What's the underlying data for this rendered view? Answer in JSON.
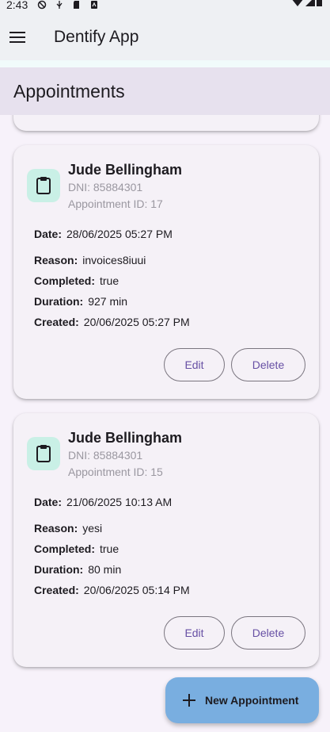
{
  "status_bar": {
    "time": "2:43"
  },
  "app_bar": {
    "title": "Dentify App"
  },
  "section": {
    "title": "Appointments"
  },
  "labels": {
    "date": "Date:",
    "reason": "Reason:",
    "completed": "Completed:",
    "duration": "Duration:",
    "created": "Created:",
    "edit": "Edit",
    "delete": "Delete"
  },
  "appointments": [
    {
      "patient": "Jude Bellingham",
      "dni": "DNI: 85884301",
      "appointment_id": "Appointment ID: 17",
      "date": "28/06/2025 05:27 PM",
      "reason": "invoices8iuui",
      "completed": "true",
      "duration": "927 min",
      "created": "20/06/2025 05:27 PM"
    },
    {
      "patient": "Jude Bellingham",
      "dni": "DNI: 85884301",
      "appointment_id": "Appointment ID: 15",
      "date": "21/06/2025 10:13 AM",
      "reason": "yesi",
      "completed": "true",
      "duration": "80 min",
      "created": "20/06/2025 05:14 PM"
    }
  ],
  "fab": {
    "label": "New Appointment",
    "icon": "plus-icon"
  },
  "colors": {
    "app_bar_bg": "#eef0f3",
    "section_bg": "#e7e1ee",
    "card_bg": "#f5f1f7",
    "icon_bg": "#c9f0e6",
    "button_text": "#6750a4",
    "fab_bg": "#79aee0"
  }
}
